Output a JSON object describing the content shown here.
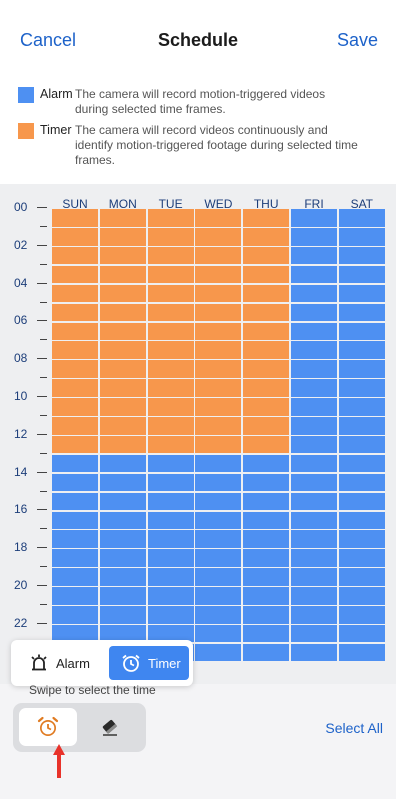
{
  "header": {
    "cancel_label": "Cancel",
    "title": "Schedule",
    "save_label": "Save"
  },
  "legend": [
    {
      "name": "Alarm",
      "color": "#4e90f2",
      "description": "The camera will record motion-triggered videos during selected time frames."
    },
    {
      "name": "Timer",
      "color": "#f7974c",
      "description": "The camera will record videos continuously and identify motion-triggered footage during selected time frames."
    }
  ],
  "grid": {
    "days": [
      "SUN",
      "MON",
      "TUE",
      "WED",
      "THU",
      "FRI",
      "SAT"
    ],
    "hour_labels": [
      "00",
      "02",
      "04",
      "06",
      "08",
      "10",
      "12",
      "14",
      "16",
      "18",
      "20",
      "22"
    ],
    "schedule": {
      "SUN": {
        "timer_hours": [
          0,
          13
        ],
        "alarm_hours": [
          13,
          24
        ]
      },
      "MON": {
        "timer_hours": [
          0,
          13
        ],
        "alarm_hours": [
          13,
          24
        ]
      },
      "TUE": {
        "timer_hours": [
          0,
          13
        ],
        "alarm_hours": [
          13,
          24
        ]
      },
      "WED": {
        "timer_hours": [
          0,
          13
        ],
        "alarm_hours": [
          13,
          24
        ]
      },
      "THU": {
        "timer_hours": [
          0,
          13
        ],
        "alarm_hours": [
          13,
          24
        ]
      },
      "FRI": {
        "timer_hours": [],
        "alarm_hours": [
          0,
          24
        ]
      },
      "SAT": {
        "timer_hours": [],
        "alarm_hours": [
          0,
          24
        ]
      }
    },
    "colors": {
      "alarm": "#4e90f2",
      "timer": "#f7974c"
    }
  },
  "mode_popup": {
    "alarm_label": "Alarm",
    "timer_label": "Timer",
    "selected": "Timer"
  },
  "footer": {
    "hint": "Swipe to select the time",
    "select_all_label": "Select All",
    "tools": [
      "alarm-clock-icon",
      "eraser-icon"
    ],
    "selected_tool": "alarm-clock-icon"
  }
}
